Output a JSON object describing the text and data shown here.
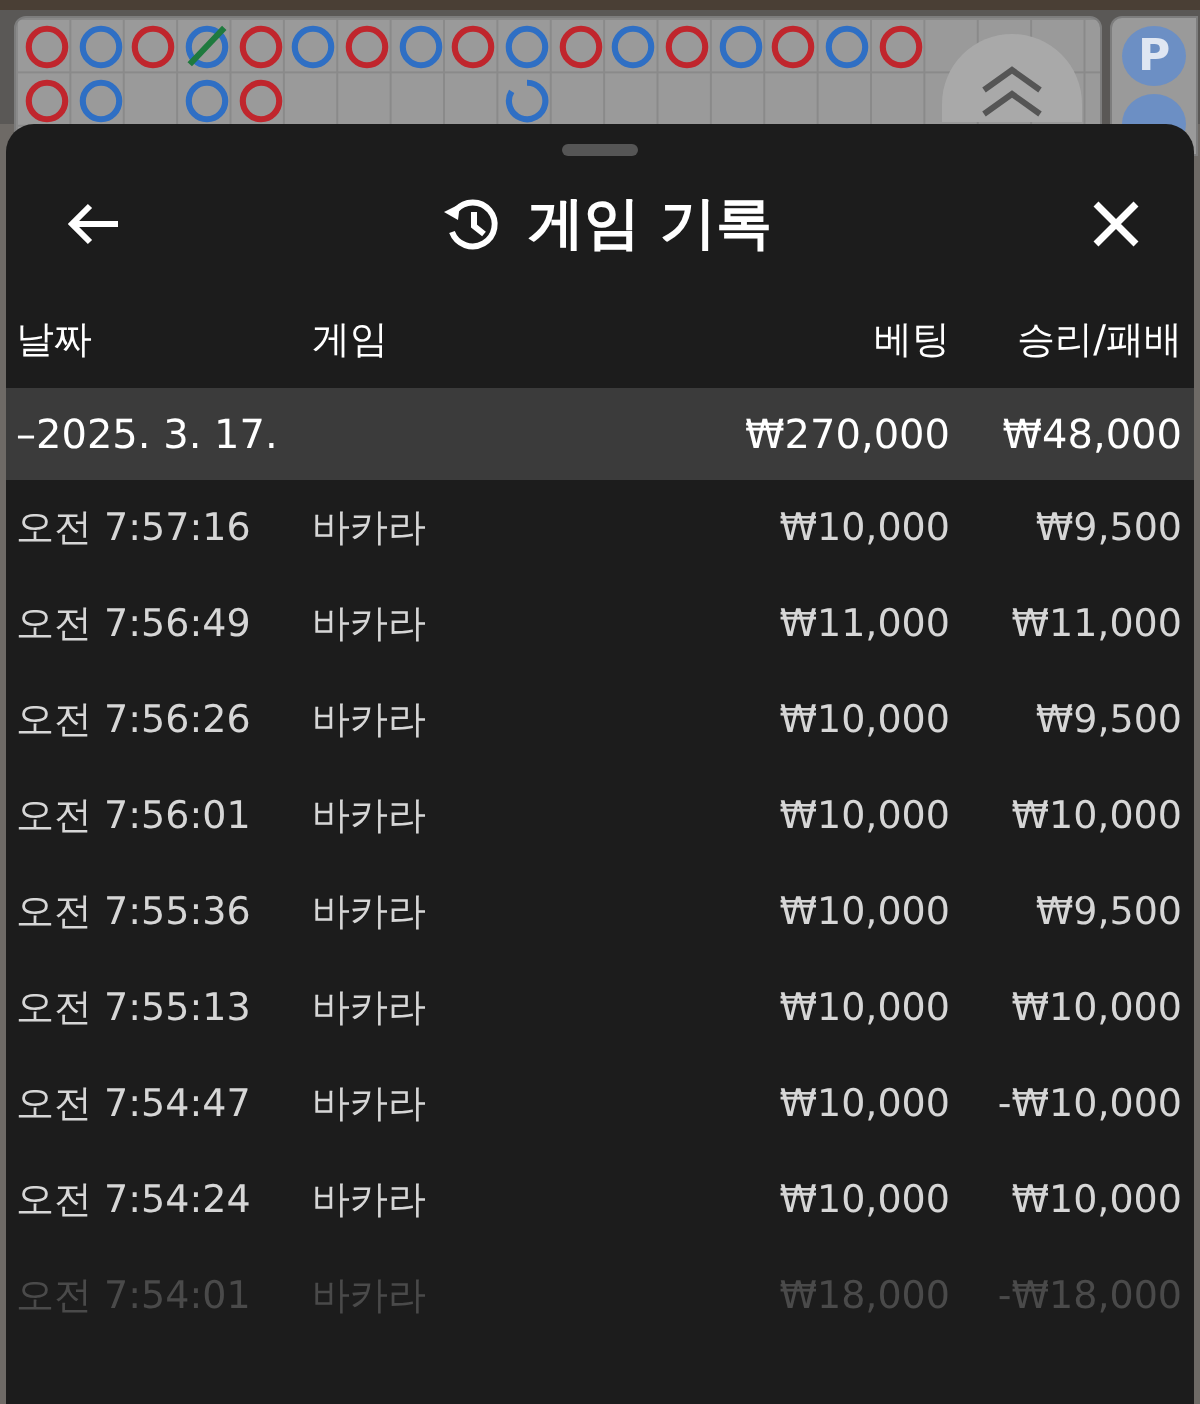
{
  "bead_road": {
    "rows": [
      [
        {
          "kind": "ring",
          "color": "#c0262d"
        },
        {
          "kind": "ring",
          "color": "#2f6fc4"
        },
        {
          "kind": "ring",
          "color": "#c0262d"
        },
        {
          "kind": "slashed",
          "color": "#2f6fc4"
        },
        {
          "kind": "ring",
          "color": "#c0262d"
        },
        {
          "kind": "ring",
          "color": "#2f6fc4"
        },
        {
          "kind": "ring",
          "color": "#c0262d"
        },
        {
          "kind": "ring",
          "color": "#2f6fc4"
        },
        {
          "kind": "ring",
          "color": "#c0262d"
        },
        {
          "kind": "ring",
          "color": "#2f6fc4"
        },
        {
          "kind": "ring",
          "color": "#c0262d"
        },
        {
          "kind": "ring",
          "color": "#2f6fc4"
        },
        {
          "kind": "ring",
          "color": "#c0262d"
        },
        {
          "kind": "ring",
          "color": "#2f6fc4"
        },
        {
          "kind": "ring",
          "color": "#c0262d"
        },
        {
          "kind": "ring",
          "color": "#2f6fc4"
        },
        {
          "kind": "ring",
          "color": "#c0262d"
        }
      ],
      [
        {
          "kind": "ring",
          "color": "#c0262d"
        },
        {
          "kind": "ring",
          "color": "#2f6fc4"
        },
        {
          "kind": "empty"
        },
        {
          "kind": "ring",
          "color": "#2f6fc4"
        },
        {
          "kind": "ring",
          "color": "#c0262d"
        },
        {
          "kind": "empty"
        },
        {
          "kind": "empty"
        },
        {
          "kind": "empty"
        },
        {
          "kind": "empty"
        },
        {
          "kind": "partial",
          "color": "#2f6fc4"
        }
      ]
    ]
  },
  "side_badge": "P",
  "sheet": {
    "title": "게임 기록",
    "columns": [
      "날짜",
      "게임",
      "베팅",
      "승리/패배"
    ],
    "summary": {
      "date": "–2025. 3. 17.",
      "bet": "₩270,000",
      "result": "₩48,000"
    },
    "rows": [
      {
        "time": "오전 7:57:16",
        "game": "바카라",
        "bet": "₩10,000",
        "result": "₩9,500",
        "faded": false
      },
      {
        "time": "오전 7:56:49",
        "game": "바카라",
        "bet": "₩11,000",
        "result": "₩11,000",
        "faded": false
      },
      {
        "time": "오전 7:56:26",
        "game": "바카라",
        "bet": "₩10,000",
        "result": "₩9,500",
        "faded": false
      },
      {
        "time": "오전 7:56:01",
        "game": "바카라",
        "bet": "₩10,000",
        "result": "₩10,000",
        "faded": false
      },
      {
        "time": "오전 7:55:36",
        "game": "바카라",
        "bet": "₩10,000",
        "result": "₩9,500",
        "faded": false
      },
      {
        "time": "오전 7:55:13",
        "game": "바카라",
        "bet": "₩10,000",
        "result": "₩10,000",
        "faded": false
      },
      {
        "time": "오전 7:54:47",
        "game": "바카라",
        "bet": "₩10,000",
        "result": "-₩10,000",
        "faded": false
      },
      {
        "time": "오전 7:54:24",
        "game": "바카라",
        "bet": "₩10,000",
        "result": "₩10,000",
        "faded": false
      },
      {
        "time": "오전 7:54:01",
        "game": "바카라",
        "bet": "₩18,000",
        "result": "-₩18,000",
        "faded": true
      }
    ]
  }
}
